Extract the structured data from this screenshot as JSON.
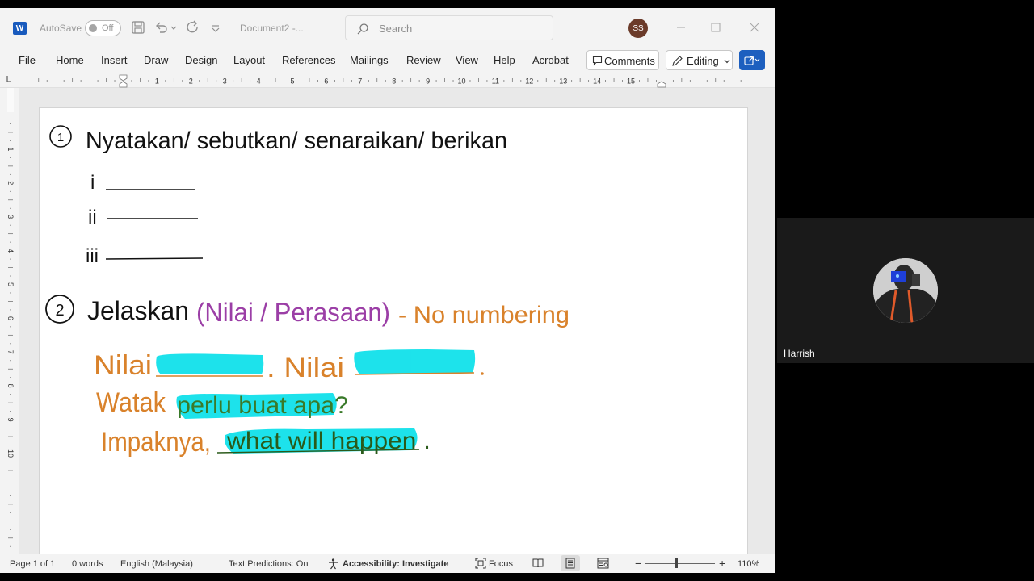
{
  "titlebar": {
    "autosave_label": "AutoSave",
    "autosave_state": "Off",
    "document_title": "Document2  -...",
    "search_placeholder": "Search",
    "user_initials": "SS"
  },
  "ribbon": {
    "tabs": [
      "File",
      "Home",
      "Insert",
      "Draw",
      "Design",
      "Layout",
      "References",
      "Mailings",
      "Review",
      "View",
      "Help",
      "Acrobat"
    ],
    "comments_label": "Comments",
    "editing_label": "Editing"
  },
  "ruler": {
    "numbers": [
      "1",
      "2",
      "3",
      "4",
      "5",
      "6",
      "7",
      "8",
      "9",
      "10",
      "11",
      "12",
      "13",
      "14",
      "15"
    ],
    "v_numbers": [
      "1",
      "2",
      "3",
      "4",
      "5",
      "6",
      "7",
      "8",
      "9",
      "10"
    ]
  },
  "document": {
    "section1": {
      "number": "1",
      "heading": "Nyatakan/ sebutkan/ senaraikan/ berikan",
      "items": [
        "i",
        "ii",
        "iii"
      ]
    },
    "section2": {
      "number": "2",
      "heading": "Jelaskan",
      "bracket": "(Nilai / Perasaan)",
      "note": "- No numbering",
      "line1_a": "Nilai",
      "line1_b": ". Nilai",
      "line2_a": "Watak",
      "line2_b": "perlu buat apa?",
      "line3_a": "Impaknya,",
      "line3_b": "what will happen ."
    }
  },
  "statusbar": {
    "page": "Page 1 of 1",
    "words": "0 words",
    "language": "English (Malaysia)",
    "predictions": "Text Predictions: On",
    "accessibility": "Accessibility: Investigate",
    "focus": "Focus",
    "zoom": "110%"
  },
  "participant": {
    "name": "Harrish"
  },
  "colors": {
    "word_blue": "#185abd",
    "ink_black": "#111111",
    "ink_purple": "#9b3ea6",
    "ink_orange": "#d9822b",
    "highlight_cyan": "#11e1ea"
  }
}
